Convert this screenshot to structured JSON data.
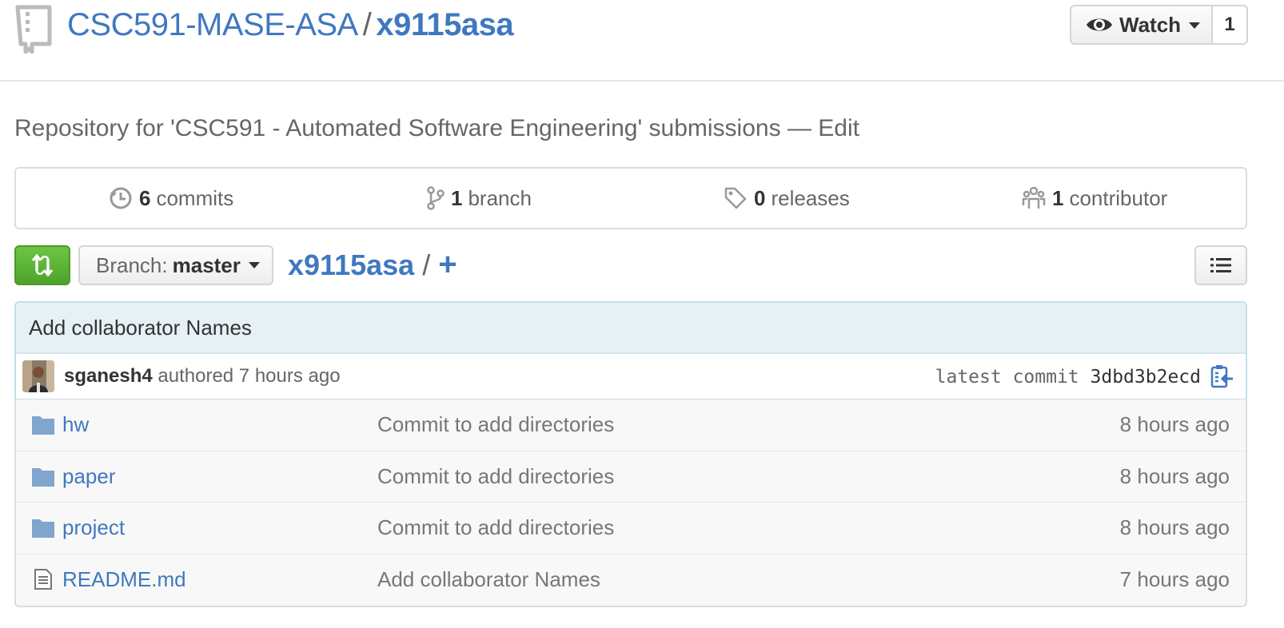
{
  "header": {
    "owner": "CSC591-MASE-ASA",
    "separator": "/",
    "repo": "x9115asa",
    "watch_label": "Watch",
    "watch_count": "1"
  },
  "description": {
    "text": "Repository for 'CSC591 - Automated Software Engineering' submissions",
    "dash": "—",
    "edit": "Edit"
  },
  "summary": [
    {
      "icon": "history-icon",
      "num": "6",
      "label": "commits"
    },
    {
      "icon": "branch-icon",
      "num": "1",
      "label": "branch"
    },
    {
      "icon": "tag-icon",
      "num": "0",
      "label": "releases"
    },
    {
      "icon": "organization-icon",
      "num": "1",
      "label": "contributor"
    }
  ],
  "toolbar": {
    "branch_prefix": "Branch:",
    "branch_name": "master",
    "path_root": "x9115asa",
    "path_sep": "/",
    "path_add": "+"
  },
  "commit": {
    "message": "Add collaborator Names",
    "author": "sganesh4",
    "authored": "authored 7 hours ago",
    "latest_label": "latest commit",
    "sha": "3dbd3b2ecd"
  },
  "files": [
    {
      "type": "dir",
      "name": "hw",
      "message": "Commit to add directories",
      "age": "8 hours ago"
    },
    {
      "type": "dir",
      "name": "paper",
      "message": "Commit to add directories",
      "age": "8 hours ago"
    },
    {
      "type": "dir",
      "name": "project",
      "message": "Commit to add directories",
      "age": "8 hours ago"
    },
    {
      "type": "file",
      "name": "README.md",
      "message": "Add collaborator Names",
      "age": "7 hours ago"
    }
  ],
  "colors": {
    "link": "#4078c0",
    "compare_green": "#6cc644",
    "commit_bar": "#e6f1f6",
    "folder": "#80a6cd"
  }
}
